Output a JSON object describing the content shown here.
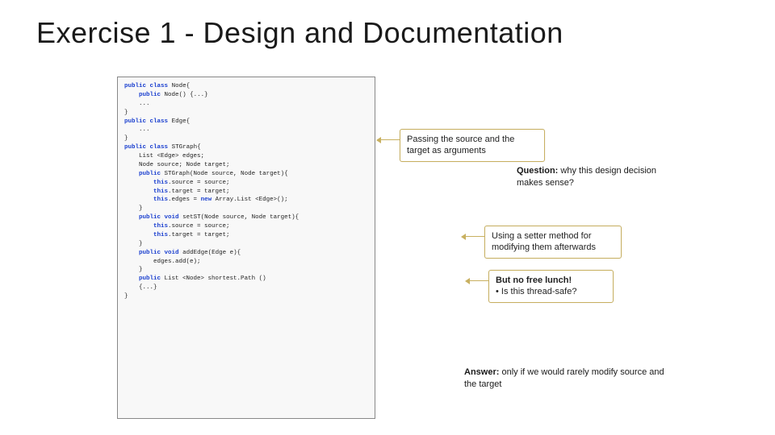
{
  "title": "Exercise 1 - Design and Documentation",
  "kw": {
    "public": "public",
    "class": "class",
    "void": "void",
    "this": "this",
    "new": "new"
  },
  "code": {
    "node": {
      "name": "Node",
      "ctor": "Node"
    },
    "edge": {
      "name": "Edge"
    },
    "graph": {
      "name": "STGraph",
      "field_edges": "List <Edge> edges;",
      "field_nodes": "Node source; Node target;",
      "ctor_sig": "STGraph(Node source, Node target)",
      "ctor_l1": "source = source;",
      "ctor_l2": "target = target;",
      "ctor_l3a": "edges = ",
      "ctor_l3b": "Array.List <Edge>();",
      "setST_sig": "setST(Node source, Node target)",
      "addEdge_sig": "addEdge(Edge e)",
      "addEdge_body": "edges.add(e);",
      "shortest_sig": "List <Node> shortest.Path ()"
    }
  },
  "callouts": {
    "passing": "Passing the source and the target as arguments",
    "setter": "Using a setter method for modifying them afterwards",
    "lunch_title": "But no free lunch!",
    "lunch_bullet": "• Is this thread-safe?"
  },
  "labels": {
    "question_b": "Question:",
    "question_t": "why this design decision makes sense?",
    "answer_b": "Answer:",
    "answer_t": "only if we would rarely modify source and the target"
  }
}
